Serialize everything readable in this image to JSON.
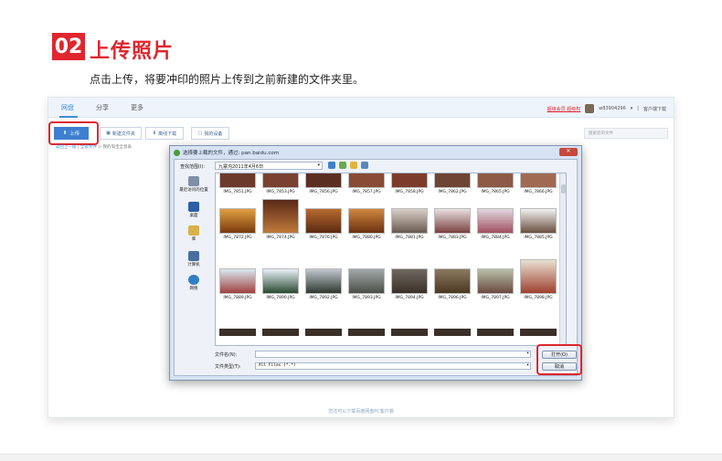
{
  "step": {
    "number": "02",
    "title": "上传照片",
    "description": "点击上传，将要冲印的照片上传到之前新建的文件夹里。"
  },
  "app": {
    "nav": [
      "网盘",
      "分享",
      "更多"
    ],
    "header_right": {
      "vip": "超级会员 超级权",
      "user": "w83904296",
      "client": "客户端下载"
    },
    "toolbar": {
      "upload": "上传",
      "new_folder": "新建文件夹",
      "offline": "离线下载",
      "devices": "我的设备"
    },
    "search_placeholder": "搜索您的文件",
    "breadcrumb": {
      "back": "返回上一级",
      "all": "全部文件",
      "current": "我的淘宝全息表"
    },
    "footer_link": "您还可以下载百度网盘PC客户端"
  },
  "dialog": {
    "title": "选择要上载的文件，通过: pan.baidu.com",
    "look_in_label": "查找范围(I):",
    "look_in_value": "九寨沟2011年4月6日",
    "places": [
      "最近访问的位置",
      "桌面",
      "库",
      "计算机",
      "网络"
    ],
    "files_row1": [
      "IMG_7851.JPG",
      "IMG_7853.JPG",
      "IMG_7856.JPG",
      "IMG_7857.JPG",
      "IMG_7858.JPG",
      "IMG_7862.JPG",
      "IMG_7865.JPG",
      "IMG_7866.JPG"
    ],
    "files_row2": [
      "IMG_7872.JPG",
      "IMG_7874.JPG",
      "IMG_7876.JPG",
      "IMG_7880.JPG",
      "IMG_7881.JPG",
      "IMG_7883.JPG",
      "IMG_7884.JPG",
      "IMG_7885.JPG"
    ],
    "files_row3": [
      "IMG_7889.JPG",
      "IMG_7890.JPG",
      "IMG_7892.JPG",
      "IMG_7893.JPG",
      "IMG_7894.JPG",
      "IMG_7896.JPG",
      "IMG_7897.JPG",
      "IMG_7898.JPG"
    ],
    "filename_label": "文件名(N):",
    "filetype_label": "文件类型(T):",
    "filetype_value": "All Files (*.*)",
    "open_button": "打开(O)",
    "cancel_button": "取消"
  },
  "colors": {
    "accent_red": "#e0262e",
    "primary_blue": "#3f7fcf"
  }
}
